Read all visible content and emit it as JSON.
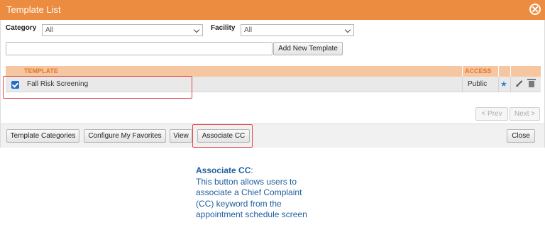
{
  "window": {
    "title": "Template List"
  },
  "filters": {
    "category_label": "Category",
    "category_value": "All",
    "facility_label": "Facility",
    "facility_value": "All"
  },
  "search": {
    "value": "",
    "placeholder": ""
  },
  "add_template_label": "Add New Template",
  "table": {
    "headers": {
      "template": "TEMPLATE",
      "access": "ACCESS"
    },
    "rows": [
      {
        "name": "Fall Risk Screening",
        "access": "Public",
        "checked": true,
        "favorite": true
      }
    ]
  },
  "pagination": {
    "prev_label": "< Prev",
    "next_label": "Next >"
  },
  "footer": {
    "template_categories": "Template Categories",
    "configure_favorites": "Configure My Favorites",
    "view": "View",
    "associate_cc": "Associate CC",
    "close": "Close"
  },
  "caption": {
    "heading": "Associate CC",
    "heading_suffix": ":",
    "lines": [
      "This button allows users to",
      "associate a Chief Complaint",
      "(CC) keyword from the",
      "appointment schedule screen"
    ]
  },
  "colors": {
    "accent": "#ec8c40",
    "header_row": "#f6c6a0",
    "highlight": "#e24848",
    "caption": "#1f5fa0",
    "checkbox": "#1f6fc8"
  },
  "icons": {
    "close": "close-circle-icon",
    "favorite": "star-icon",
    "edit": "pencil-icon",
    "delete": "trash-icon"
  }
}
